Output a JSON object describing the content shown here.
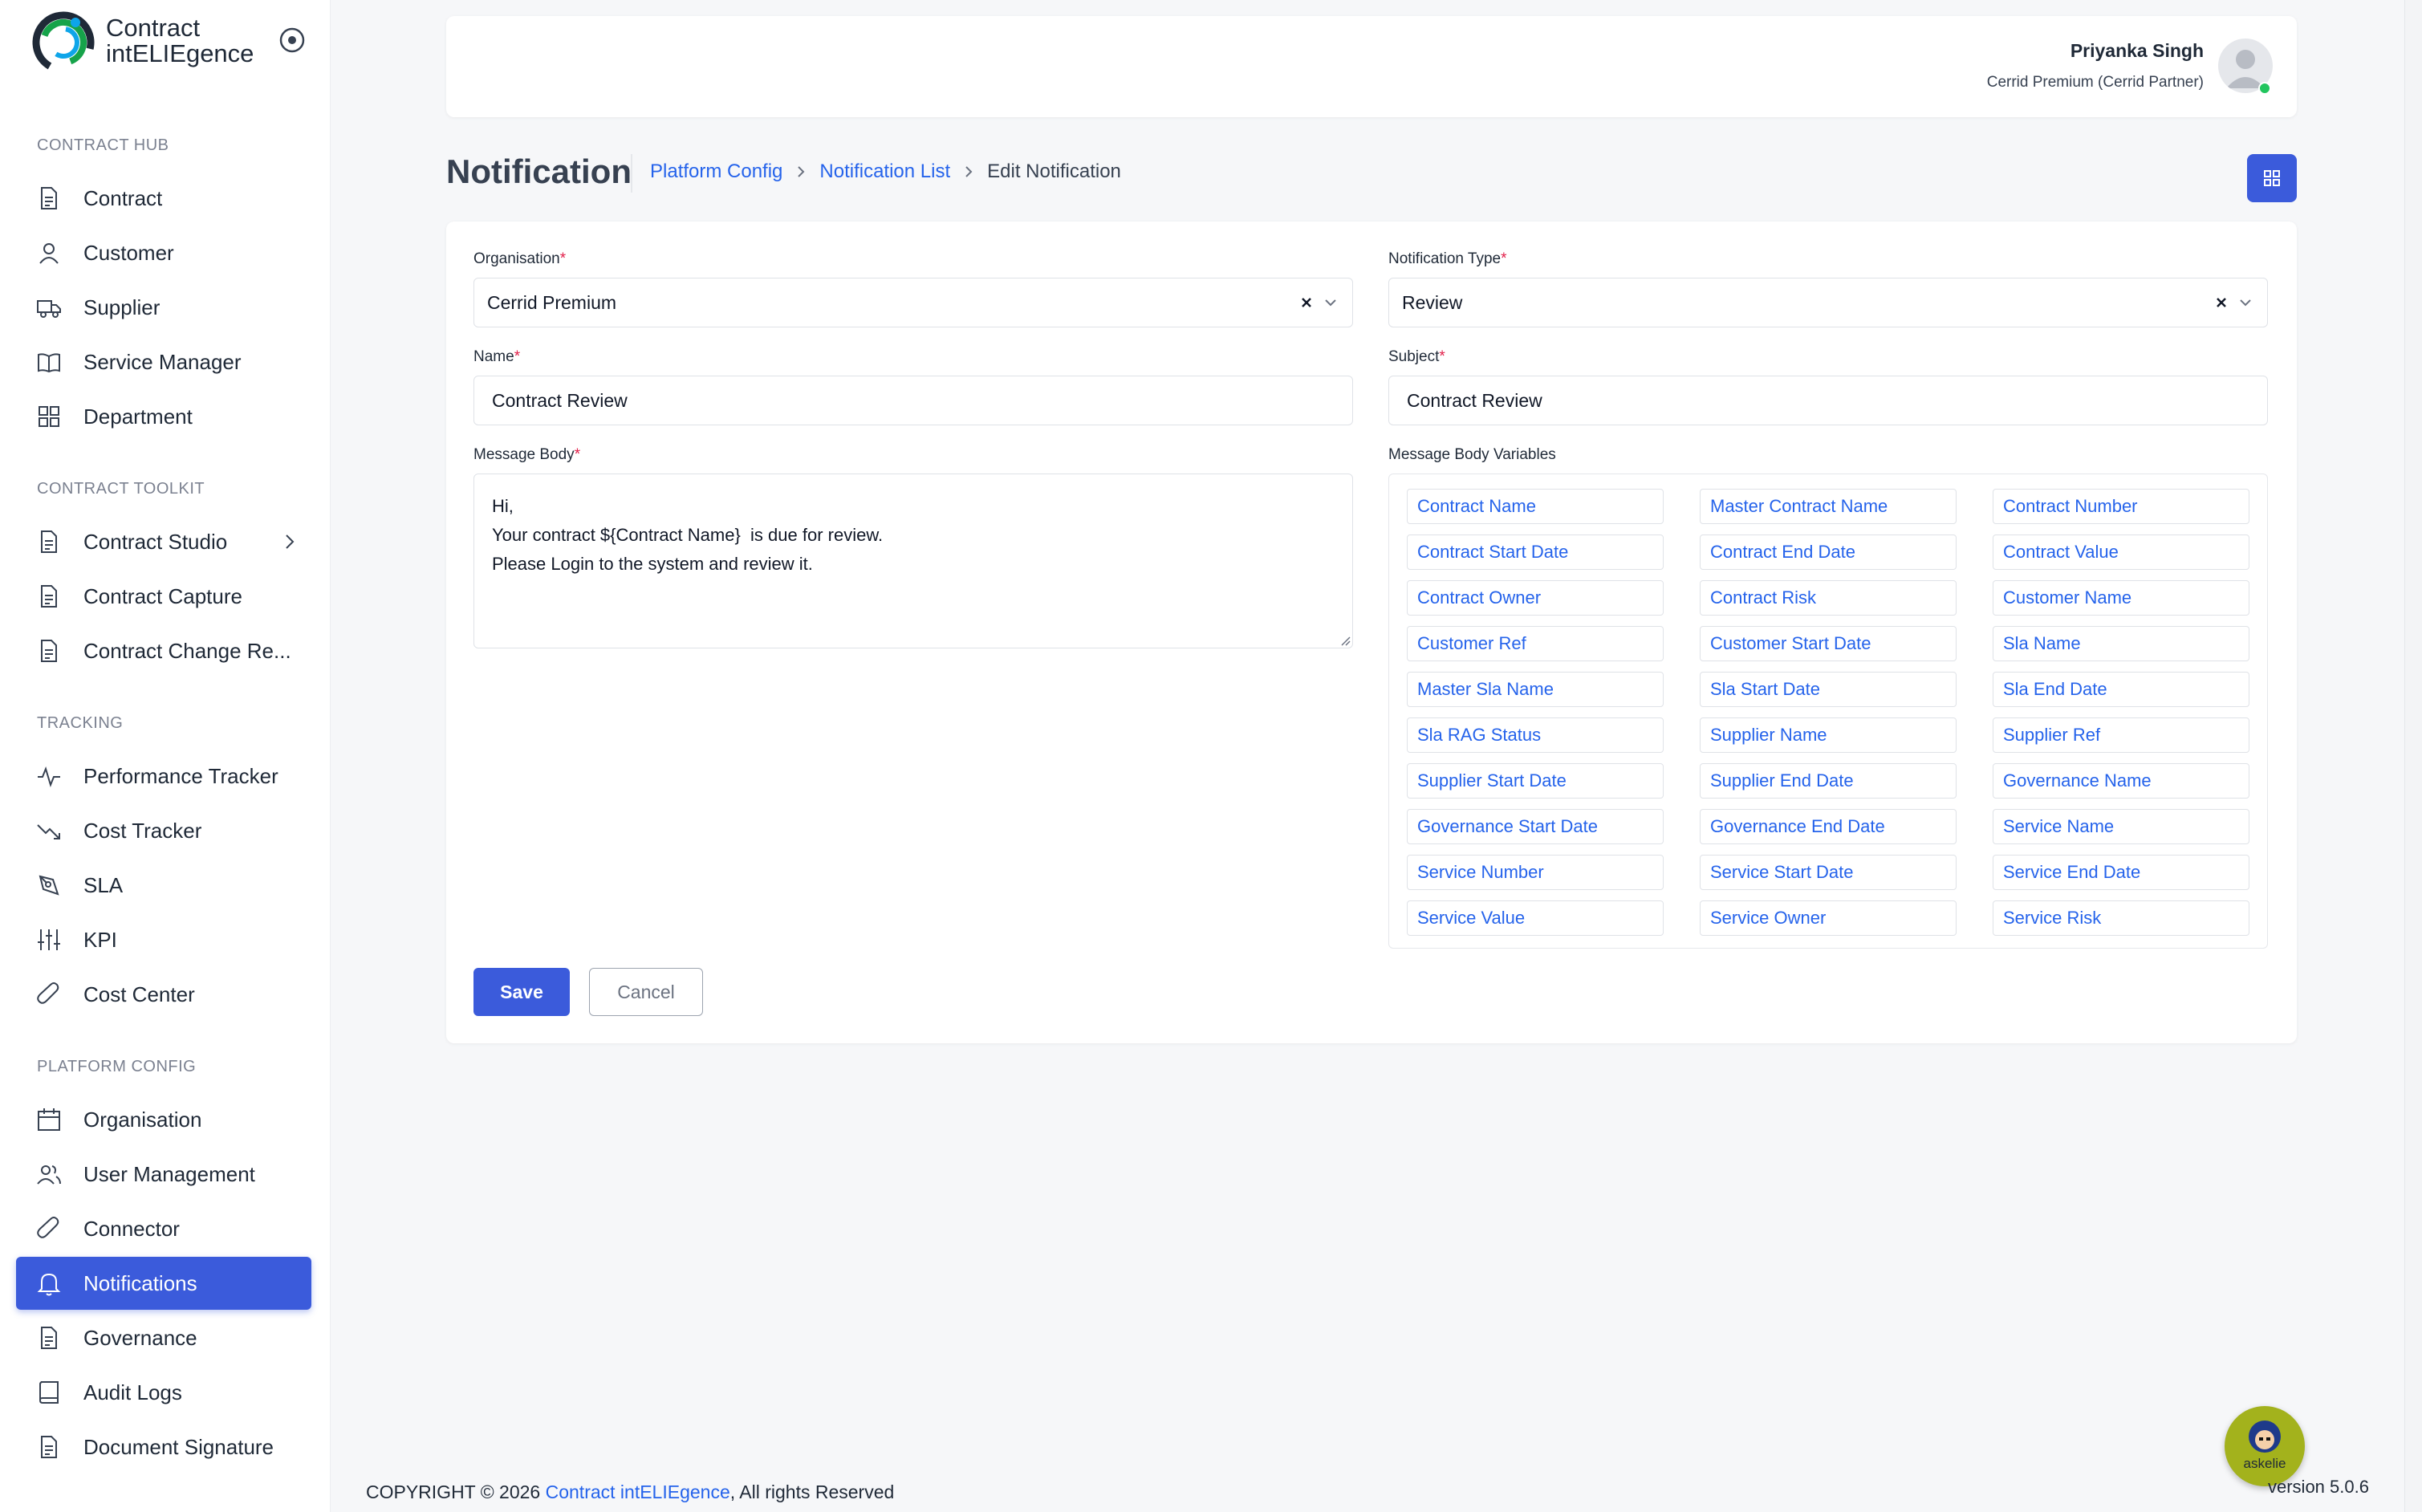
{
  "app": {
    "logo_line1": "Contract",
    "logo_line2": "intELIEgence"
  },
  "sidebar": {
    "sections": [
      {
        "title": "CONTRACT HUB",
        "items": [
          {
            "label": "Contract",
            "icon": "document-icon"
          },
          {
            "label": "Customer",
            "icon": "user-icon"
          },
          {
            "label": "Supplier",
            "icon": "truck-icon"
          },
          {
            "label": "Service Manager",
            "icon": "book-open-icon"
          },
          {
            "label": "Department",
            "icon": "grid-icon"
          }
        ]
      },
      {
        "title": "CONTRACT TOOLKIT",
        "items": [
          {
            "label": "Contract Studio",
            "icon": "document-icon",
            "has_submenu": true
          },
          {
            "label": "Contract Capture",
            "icon": "document-icon"
          },
          {
            "label": "Contract Change Re...",
            "icon": "document-icon"
          }
        ]
      },
      {
        "title": "TRACKING",
        "items": [
          {
            "label": "Performance Tracker",
            "icon": "activity-icon"
          },
          {
            "label": "Cost Tracker",
            "icon": "trending-down-icon"
          },
          {
            "label": "SLA",
            "icon": "pen-tool-icon"
          },
          {
            "label": "KPI",
            "icon": "sliders-icon"
          },
          {
            "label": "Cost Center",
            "icon": "paperclip-icon"
          }
        ]
      },
      {
        "title": "PLATFORM CONFIG",
        "items": [
          {
            "label": "Organisation",
            "icon": "calendar-icon"
          },
          {
            "label": "User Management",
            "icon": "users-icon"
          },
          {
            "label": "Connector",
            "icon": "paperclip-icon"
          },
          {
            "label": "Notifications",
            "icon": "bell-icon",
            "active": true
          },
          {
            "label": "Governance",
            "icon": "document-icon"
          },
          {
            "label": "Audit Logs",
            "icon": "book-icon"
          },
          {
            "label": "Document Signature",
            "icon": "document-icon"
          }
        ]
      }
    ]
  },
  "header": {
    "user_name": "Priyanka Singh",
    "user_org": "Cerrid Premium (Cerrid Partner)"
  },
  "page": {
    "title": "Notification",
    "breadcrumb": [
      "Platform Config",
      "Notification List",
      "Edit Notification"
    ]
  },
  "form": {
    "organisation_label": "Organisation",
    "organisation_value": "Cerrid Premium",
    "notification_type_label": "Notification Type",
    "notification_type_value": "Review",
    "name_label": "Name",
    "name_value": "Contract Review",
    "subject_label": "Subject",
    "subject_value": "Contract Review",
    "message_body_label": "Message Body",
    "message_body_lines": [
      "Hi,",
      "Your contract ${Contract Name}  is due for review.",
      "Please Login to the system and review it."
    ],
    "variables_label": "Message Body Variables",
    "variables": [
      "Contract Name",
      "Master Contract Name",
      "Contract Number",
      "Contract Start Date",
      "Contract End Date",
      "Contract Value",
      "Contract Owner",
      "Contract Risk",
      "Customer Name",
      "Customer Ref",
      "Customer Start Date",
      "Sla Name",
      "Master Sla Name",
      "Sla Start Date",
      "Sla End Date",
      "Sla RAG Status",
      "Supplier Name",
      "Supplier Ref",
      "Supplier Start Date",
      "Supplier End Date",
      "Governance Name",
      "Governance Start Date",
      "Governance End Date",
      "Service Name",
      "Service Number",
      "Service Start Date",
      "Service End Date",
      "Service Value",
      "Service Owner",
      "Service Risk"
    ],
    "required_mark": "*",
    "save_label": "Save",
    "cancel_label": "Cancel"
  },
  "footer": {
    "copyright_prefix": "COPYRIGHT © 2026 ",
    "brand": "Contract intELIEgence",
    "copyright_suffix": ", All rights Reserved",
    "version": "version 5.0.6",
    "assistant_label": "askelie"
  },
  "colors": {
    "accent": "#3b5bdb",
    "link": "#2563eb",
    "required": "#e11d48",
    "online": "#22c55e"
  }
}
